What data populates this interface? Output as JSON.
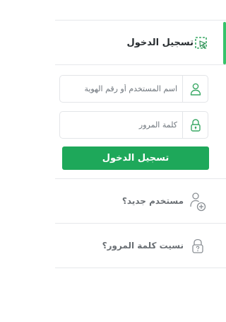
{
  "login": {
    "title": "تسجيل الدخول",
    "username_placeholder": "اسم المستخدم أو رقم الهوية",
    "password_placeholder": "كلمة المرور",
    "submit_label": "تسجيل الدخول"
  },
  "links": {
    "new_user": "مستخدم جديد؟",
    "forgot_password": "نسيت كلمة المرور؟"
  },
  "colors": {
    "accent": "#36c36b",
    "button": "#1ea85a",
    "icon": "#3aa865"
  },
  "icons": {
    "header": "cursor-select-icon",
    "username": "user-icon",
    "password": "lock-icon",
    "new_user": "add-user-icon",
    "forgot_password": "lock-question-icon"
  }
}
